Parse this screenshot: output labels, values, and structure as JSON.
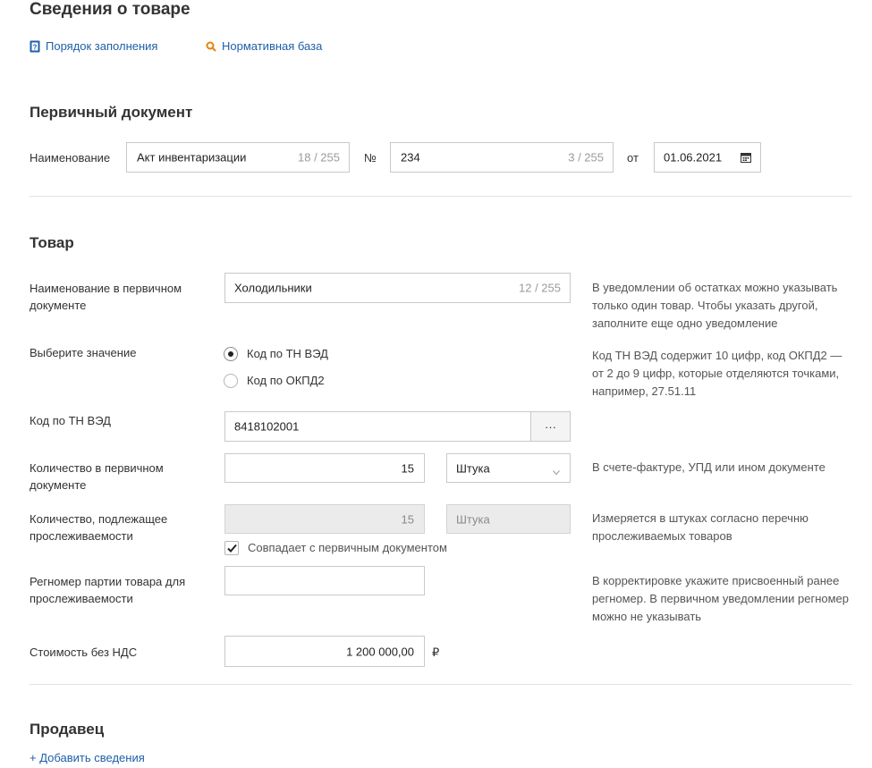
{
  "page": {
    "title": "Сведения о товаре",
    "links": {
      "fill_order": "Порядок заполнения",
      "normative_base": "Нормативная база"
    }
  },
  "primary_doc": {
    "heading": "Первичный документ",
    "name_label": "Наименование",
    "name_value": "Акт инвентаризации",
    "name_counter": "18 / 255",
    "number_label": "№",
    "number_value": "234",
    "number_counter": "3 / 255",
    "date_label": "от",
    "date_value": "01.06.2021"
  },
  "goods": {
    "heading": "Товар",
    "name_label": "Наименование в первичном документе",
    "name_value": "Холодильники",
    "name_counter": "12 / 255",
    "name_hint": "В уведомлении об остатках можно указывать только один товар. Чтобы указать другой, заполните еще одно уведомление",
    "choose_label": "Выберите значение",
    "radio_options": [
      "Код по ТН ВЭД",
      "Код по ОКПД2"
    ],
    "radio_selected": 0,
    "choose_hint": "Код ТН ВЭД содержит 10 цифр, код ОКПД2 — от 2 до 9 цифр, которые отделяются точками, например, 27.51.11",
    "code_label": "Код по ТН ВЭД",
    "code_value": "8418102001",
    "code_button": "···",
    "qty_label": "Количество в первичном документе",
    "qty_value": "15",
    "qty_unit": "Штука",
    "qty_hint": "В счете-фактуре, УПД или ином документе",
    "traced_qty_label": "Количество, подлежащее прослеживаемости",
    "traced_qty_value": "15",
    "traced_qty_unit": "Штука",
    "traced_qty_hint": "Измеряется в штуках согласно перечню прослеживаемых товаров",
    "match_checkbox_label": "Совпадает с первичным документом",
    "match_checked": true,
    "regnum_label": "Регномер партии товара для прослеживаемости",
    "regnum_value": "",
    "regnum_hint": "В корректировке укажите присвоенный ранее регномер. В первичном уведомлении регномер можно не указывать",
    "cost_label": "Стоимость без НДС",
    "cost_value": "1 200 000,00",
    "currency": "₽"
  },
  "seller": {
    "heading": "Продавец",
    "add_link": "+ Добавить сведения"
  },
  "colors": {
    "link": "#1f5fa8",
    "search_icon": "#e8830c",
    "doc_icon": "#1f5fa8"
  },
  "icons": {
    "fill_order": "document-help-icon",
    "normative_base": "search-icon",
    "date": "calendar-icon",
    "select": "chevron-down-icon",
    "checkbox": "checkmark-icon"
  }
}
